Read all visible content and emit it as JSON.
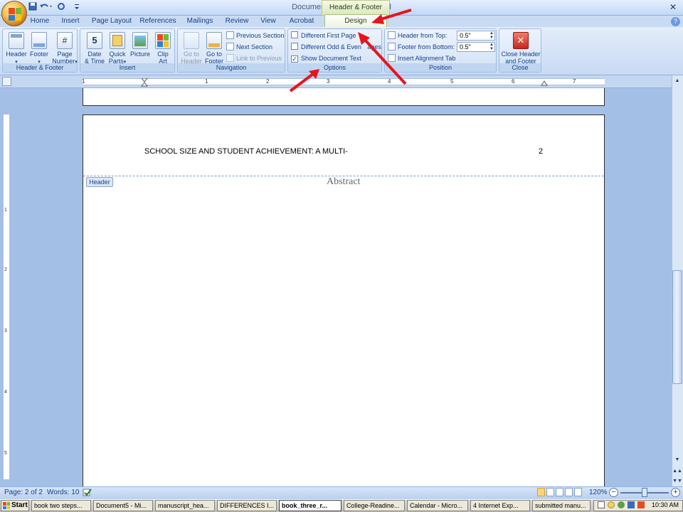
{
  "window": {
    "title": "Document5 - Microsoft Word",
    "contextual_tab_group": "Header & Footer Tools"
  },
  "tabs": [
    {
      "label": "Home"
    },
    {
      "label": "Insert"
    },
    {
      "label": "Page Layout"
    },
    {
      "label": "References"
    },
    {
      "label": "Mailings"
    },
    {
      "label": "Review"
    },
    {
      "label": "View"
    },
    {
      "label": "Acrobat"
    },
    {
      "label": "Design"
    }
  ],
  "ribbon": {
    "header_footer": {
      "label": "Header & Footer",
      "header": "Header",
      "footer": "Footer",
      "page_number_line1": "Page",
      "page_number_line2": "Number"
    },
    "insert": {
      "label": "Insert",
      "date_time_line1": "Date",
      "date_time_line2": "& Time",
      "quick_parts_line1": "Quick",
      "quick_parts_line2": "Parts",
      "picture": "Picture",
      "clip_art_line1": "Clip",
      "clip_art_line2": "Art"
    },
    "navigation": {
      "label": "Navigation",
      "go_to_header_line1": "Go to",
      "go_to_header_line2": "Header",
      "go_to_footer_line1": "Go to",
      "go_to_footer_line2": "Footer",
      "previous_section": "Previous Section",
      "next_section": "Next Section",
      "link_to_previous": "Link to Previous"
    },
    "options": {
      "label": "Options",
      "different_first_page": "Different First Page",
      "different_odd_even_part1": "Different Odd & Even ",
      "different_odd_even_part2": "ages",
      "show_document_text": "Show Document Text",
      "show_document_text_checked": true
    },
    "position": {
      "label": "Position",
      "header_from_top": "Header from Top:",
      "header_from_top_value": "0.5\"",
      "footer_from_bottom": "Footer from Bottom:",
      "footer_from_bottom_value": "0.5\"",
      "insert_alignment_tab": "Insert Alignment Tab"
    },
    "close": {
      "label": "Close",
      "close_line1": "Close Header",
      "close_line2": "and Footer"
    }
  },
  "ruler": {
    "numbers": [
      "1",
      "1",
      "2",
      "3",
      "4",
      "5",
      "6",
      "7"
    ]
  },
  "vertical_ruler": {
    "numbers": [
      "1",
      "2",
      "3",
      "4",
      "5"
    ]
  },
  "document": {
    "running_head": "SCHOOL SIZE AND STUDENT ACHIEVEMENT: A MULTI-",
    "page_number": "2",
    "header_tag": "Header",
    "abstract_heading": "Abstract"
  },
  "status": {
    "page": "Page: 2 of 2",
    "words": "Words: 10",
    "zoom": "120%"
  },
  "taskbar": {
    "start": "Start",
    "items": [
      "book two steps...",
      "Document5 - Mi...",
      "manuscript_hea...",
      "DIFFERENCES I...",
      "book_three_r...",
      "College-Readine...",
      "Calendar - Micro...",
      "4 Internet Exp...",
      "submitted manu..."
    ],
    "clock": "10:30 AM"
  },
  "colors": {
    "accent_arrow": "#e8141c",
    "ribbon_blue": "#15428b",
    "design_tab_green": "#eef3e0"
  }
}
